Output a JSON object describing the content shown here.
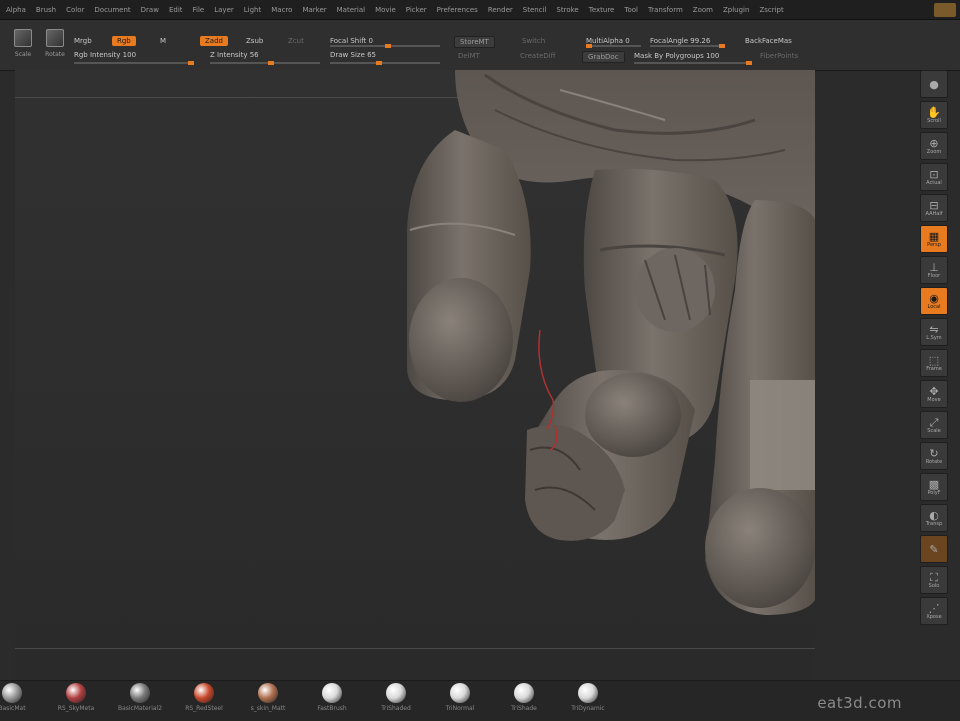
{
  "menu": [
    "Alpha",
    "Brush",
    "Color",
    "Document",
    "Draw",
    "Edit",
    "File",
    "Layer",
    "Light",
    "Macro",
    "Marker",
    "Material",
    "Movie",
    "Picker",
    "Preferences",
    "Render",
    "Stencil",
    "Stroke",
    "Texture",
    "Tool",
    "Transform",
    "Zoom",
    "Zplugin",
    "Zscript"
  ],
  "toolbar": {
    "scale_label": "Scale",
    "rotate_label": "Rotate",
    "mrgb": "Mrgb",
    "rgb": "Rgb",
    "m": "M",
    "zadd": "Zadd",
    "zsub": "Zsub",
    "zcut": "Zcut",
    "rgb_intensity": "Rgb Intensity 100",
    "z_intensity": "Z Intensity 56",
    "z_intensity_value": 56,
    "focal_shift": "Focal Shift 0",
    "draw_size": "Draw Size 65",
    "storemt": "StoreMT",
    "switch": "Switch",
    "delmt": "DelMT",
    "creatediff": "CreateDiff",
    "multialpha": "MultiAlpha 0",
    "focalangle": "FocalAngle 99.26",
    "backfacemask": "BackFaceMas",
    "grabdoc": "GrabDoc",
    "mask_by_polygroups": "Mask By Polygroups 100",
    "fiberpoints": "FiberPoints"
  },
  "right_shelf": [
    {
      "label": "",
      "icon": "material-sphere-icon",
      "glyph": "●"
    },
    {
      "label": "Scroll",
      "icon": "scroll-icon",
      "glyph": "✋"
    },
    {
      "label": "Zoom",
      "icon": "zoom-icon",
      "glyph": "⊕"
    },
    {
      "label": "Actual",
      "icon": "actual-icon",
      "glyph": "⊡"
    },
    {
      "label": "AAHalf",
      "icon": "aahalf-icon",
      "glyph": "⊟"
    },
    {
      "label": "Persp",
      "icon": "persp-icon",
      "glyph": "▦",
      "active": true
    },
    {
      "label": "Floor",
      "icon": "floor-icon",
      "glyph": "⊥"
    },
    {
      "label": "Local",
      "icon": "local-icon",
      "glyph": "◉",
      "active": true
    },
    {
      "label": "L.Sym",
      "icon": "lsym-icon",
      "glyph": "⇋"
    },
    {
      "label": "Frame",
      "icon": "frame-icon",
      "glyph": "⬚"
    },
    {
      "label": "Move",
      "icon": "move-icon",
      "glyph": "✥"
    },
    {
      "label": "Scale",
      "icon": "scale-icon",
      "glyph": "⤢"
    },
    {
      "label": "Rotate",
      "icon": "rotate-icon",
      "glyph": "↻"
    },
    {
      "label": "PolyF",
      "icon": "polyframe-icon",
      "glyph": "▩"
    },
    {
      "label": "Transp",
      "icon": "transp-icon",
      "glyph": "◐"
    },
    {
      "label": "",
      "icon": "ghost-icon",
      "glyph": "✎",
      "brown": true
    },
    {
      "label": "Solo",
      "icon": "solo-icon",
      "glyph": "⛶"
    },
    {
      "label": "Xpose",
      "icon": "xpose-icon",
      "glyph": "⋰"
    }
  ],
  "materials": [
    {
      "name": "BasicMat",
      "color": "#9a9a9a"
    },
    {
      "name": "RS_SkyMeta",
      "color": "#b04040"
    },
    {
      "name": "BasicMaterial2",
      "color": "#7a7a7a"
    },
    {
      "name": "RS_RedSteel",
      "color": "#c8482a"
    },
    {
      "name": "s_skin_Matt",
      "color": "#b07050"
    },
    {
      "name": "FastBrush",
      "color": "#d9d9d9"
    },
    {
      "name": "TriShaded",
      "color": "#d9d9d9"
    },
    {
      "name": "TriNormal",
      "color": "#d9d9d9"
    },
    {
      "name": "TriShade",
      "color": "#d9d9d9"
    },
    {
      "name": "TriDynamic",
      "color": "#d9d9d9"
    }
  ],
  "watermark": "eat3d.com",
  "colors": {
    "accent": "#e87a1f",
    "clay": "#6e6660",
    "background": "#2b2b2b"
  }
}
